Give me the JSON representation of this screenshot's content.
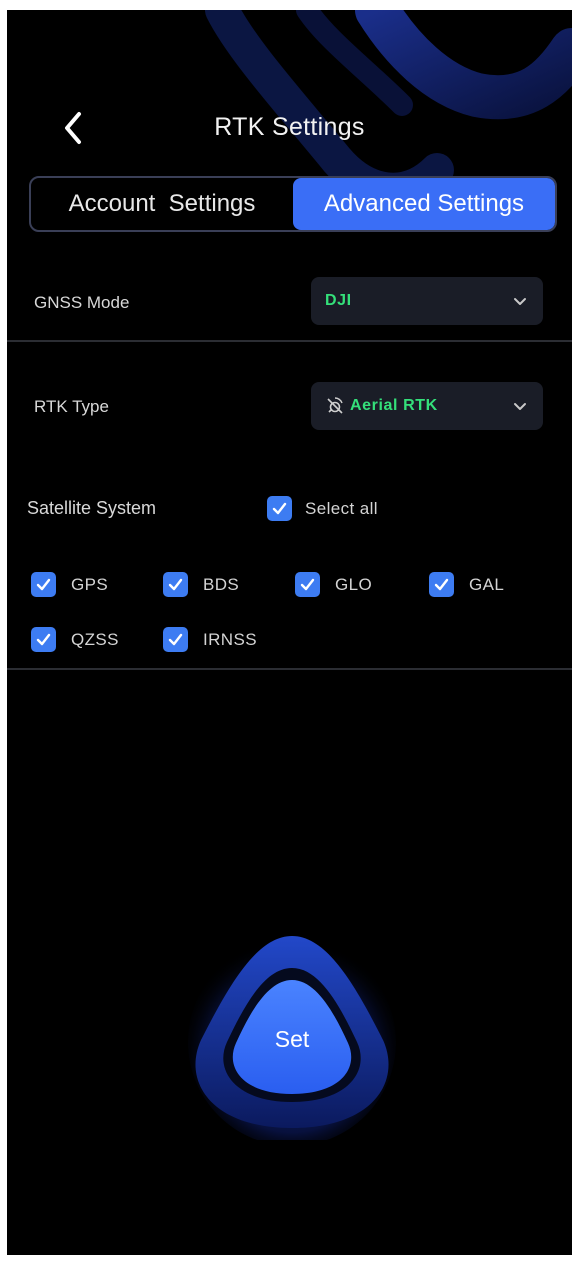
{
  "header": {
    "title": "RTK Settings",
    "back_icon": "chevron-left-icon"
  },
  "tabs": [
    {
      "label": "Account  Settings",
      "active": false
    },
    {
      "label": "Advanced Settings",
      "active": true
    }
  ],
  "gnss_mode": {
    "label": "GNSS Mode",
    "value": "DJI",
    "icon": "chevron-down-icon"
  },
  "rtk_type": {
    "label": "RTK Type",
    "value": "Aerial RTK",
    "value_icon": "satellite-icon",
    "icon": "chevron-down-icon"
  },
  "satellite_system": {
    "label": "Satellite System",
    "select_all": {
      "label": "Select all",
      "checked": true
    },
    "systems": [
      {
        "label": "GPS",
        "checked": true
      },
      {
        "label": "BDS",
        "checked": true
      },
      {
        "label": "GLO",
        "checked": true
      },
      {
        "label": "GAL",
        "checked": true
      },
      {
        "label": "QZSS",
        "checked": true
      },
      {
        "label": "IRNSS",
        "checked": true
      }
    ]
  },
  "set_button": {
    "label": "Set"
  },
  "colors": {
    "background": "#000000",
    "accent": "#3a6ef6",
    "checkbox": "#3d7cf2",
    "value_green": "#34e07a",
    "dropdown_bg": "#1a1d27"
  }
}
